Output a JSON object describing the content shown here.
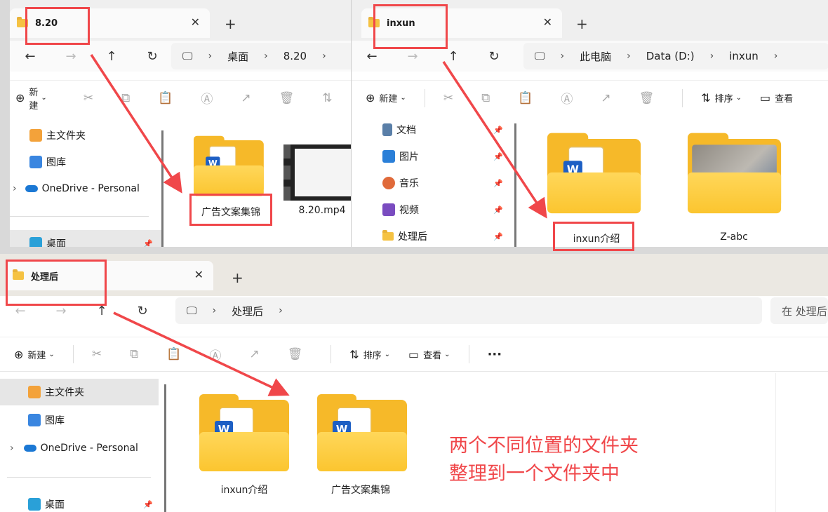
{
  "win1": {
    "tab_title": "8.20",
    "addr": [
      "桌面",
      "8.20"
    ],
    "toolbar": {
      "new_label": "新建"
    },
    "sidebar": {
      "items": [
        "主文件夹",
        "图库",
        "OneDrive - Personal",
        "桌面"
      ]
    },
    "files": [
      "广告文案集锦",
      "8.20.mp4"
    ]
  },
  "win2": {
    "tab_title": "inxun",
    "addr": [
      "此电脑",
      "Data (D:)",
      "inxun"
    ],
    "toolbar": {
      "new_label": "新建",
      "sort_label": "排序",
      "view_label": "查看"
    },
    "sidebar": {
      "items": [
        "文档",
        "图片",
        "音乐",
        "视频",
        "处理后"
      ]
    },
    "files": [
      "inxun介绍",
      "Z-abc"
    ]
  },
  "win3": {
    "tab_title": "处理后",
    "addr": [
      "处理后"
    ],
    "search_placeholder": "在 处理后",
    "toolbar": {
      "new_label": "新建",
      "sort_label": "排序",
      "view_label": "查看",
      "more_label": "···"
    },
    "sidebar": {
      "items": [
        "主文件夹",
        "图库",
        "OneDrive - Personal",
        "桌面"
      ]
    },
    "files": [
      "inxun介绍",
      "广告文案集锦"
    ]
  },
  "annotation": {
    "line1": "两个不同位置的文件夹",
    "line2": "整理到一个文件夹中"
  },
  "colors": {
    "accent_red": "#f0474a",
    "folder": "#f6b929",
    "word": "#1d5fc4"
  }
}
